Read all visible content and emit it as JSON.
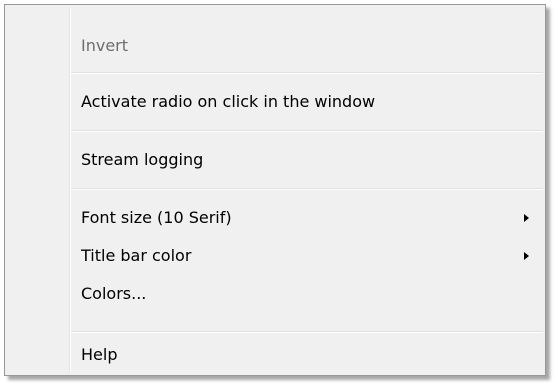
{
  "menu": {
    "items": [
      {
        "label": "Invert",
        "disabled": true
      },
      {
        "label": "Activate radio on click in the window"
      },
      {
        "label": "Stream logging"
      },
      {
        "label": "Font size (10 Serif)",
        "submenu": true
      },
      {
        "label": "Title bar color",
        "submenu": true
      },
      {
        "label": "Colors..."
      },
      {
        "label": "Help"
      }
    ]
  }
}
